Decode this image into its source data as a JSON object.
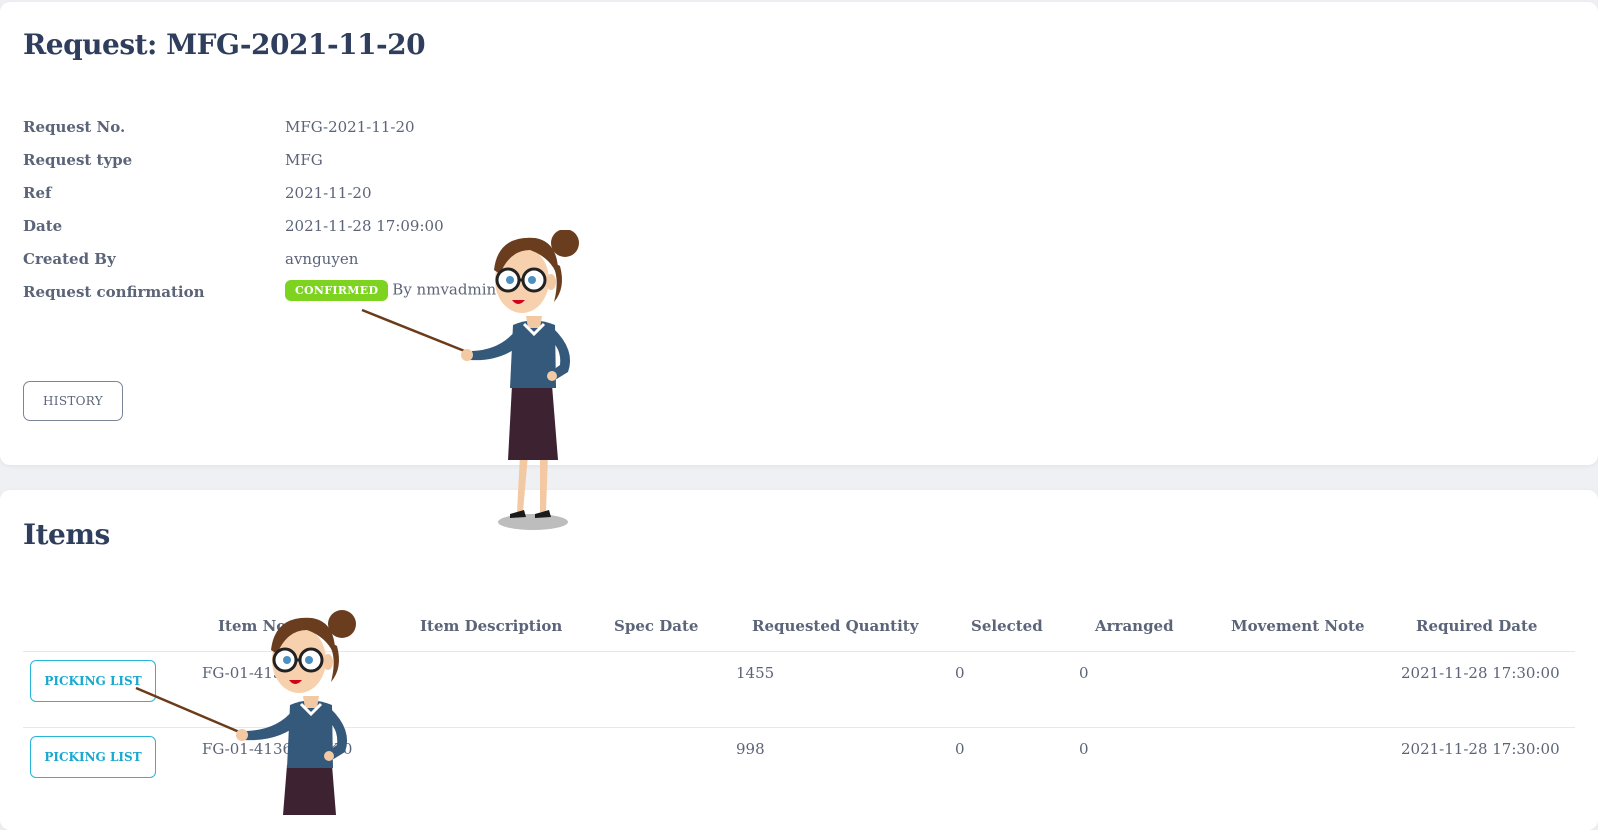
{
  "request": {
    "title": "Request: MFG-2021-11-20",
    "fields": [
      {
        "label": "Request No.",
        "value": "MFG-2021-11-20"
      },
      {
        "label": "Request type",
        "value": "MFG"
      },
      {
        "label": "Ref",
        "value": "2021-11-20"
      },
      {
        "label": "Date",
        "value": "2021-11-28 17:09:00"
      },
      {
        "label": "Created By",
        "value": "avnguyen"
      }
    ],
    "confirmation": {
      "label": "Request confirmation",
      "badge": "CONFIRMED",
      "by_text": "By nmvadmin",
      "badge_color": "#7ed321"
    },
    "history_button": "HISTORY"
  },
  "items": {
    "title": "Items",
    "columns": [
      "Item No",
      "Item Description",
      "Spec Date",
      "Requested Quantity",
      "Selected",
      "Arranged",
      "Movement Note",
      "Required Date"
    ],
    "rows": [
      {
        "action": "PICKING LIST",
        "item_no": "FG-01-4136",
        "requested_quantity": "1455",
        "selected": "0",
        "arranged": "0",
        "required_date": "2021-11-28 17:30:00"
      },
      {
        "action": "PICKING LIST",
        "item_no": "FG-01-41361-BLK-0",
        "requested_quantity": "998",
        "selected": "0",
        "arranged": "0",
        "required_date": "2021-11-28 17:30:00"
      }
    ]
  },
  "colors": {
    "accent": "#19a8cf",
    "heading": "#2f3e5c",
    "text": "#5b6478"
  },
  "overlays": [
    "teacher-pointer-illustration",
    "teacher-pointer-illustration"
  ]
}
